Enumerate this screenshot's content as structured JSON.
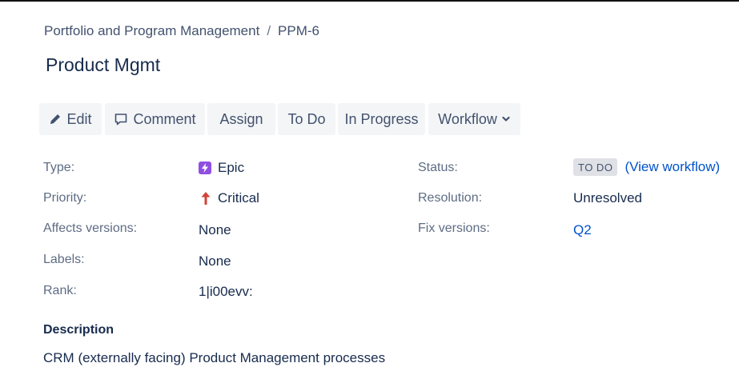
{
  "breadcrumb": {
    "project": "Portfolio and Program Management",
    "separator": "/",
    "issue_key": "PPM-6"
  },
  "issue": {
    "title": "Product Mgmt"
  },
  "toolbar": {
    "edit_label": "Edit",
    "comment_label": "Comment",
    "assign_label": "Assign",
    "todo_label": "To Do",
    "in_progress_label": "In Progress",
    "workflow_label": "Workflow"
  },
  "details": {
    "type_label": "Type:",
    "type_value": "Epic",
    "priority_label": "Priority:",
    "priority_value": "Critical",
    "affects_label": "Affects versions:",
    "affects_value": "None",
    "labels_label": "Labels:",
    "labels_value": "None",
    "rank_label": "Rank:",
    "rank_value": "1|i00evv:",
    "status_label": "Status:",
    "status_value": "TO DO",
    "view_workflow": "(View workflow)",
    "resolution_label": "Resolution:",
    "resolution_value": "Unresolved",
    "fix_label": "Fix versions:",
    "fix_value": "Q2"
  },
  "description": {
    "heading": "Description",
    "text": "CRM (externally facing) Product Management processes"
  },
  "colors": {
    "link": "#0052cc",
    "epic": "#904ee2",
    "critical": "#d04437",
    "button_bg": "#f4f5f7"
  },
  "icons": {
    "edit": "pencil-icon",
    "comment": "comment-icon",
    "workflow": "chevron-down-icon",
    "type": "epic-icon",
    "priority": "priority-critical-icon"
  }
}
